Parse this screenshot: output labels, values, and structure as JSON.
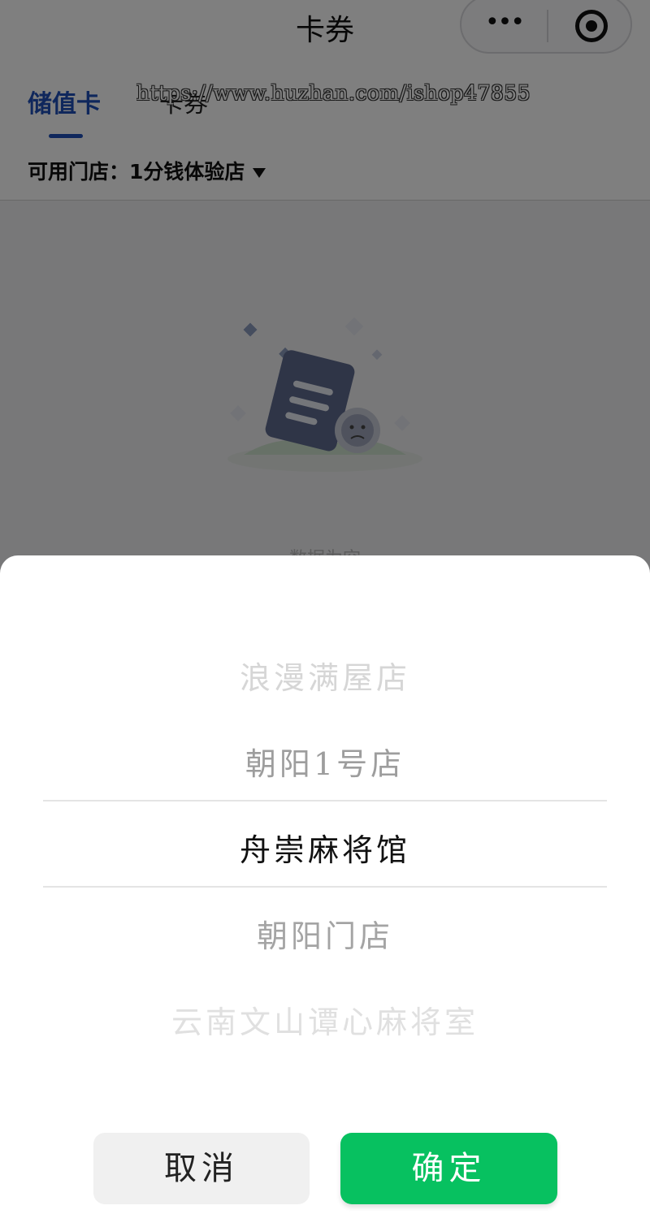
{
  "navbar": {
    "title": "卡券",
    "more_icon": "•••",
    "target_icon": "target-icon"
  },
  "tabs": [
    {
      "label": "储值卡",
      "active": true
    },
    {
      "label": "卡券",
      "active": false
    }
  ],
  "watermark": "https://www.huzhan.com/ishop47855",
  "store_filter": {
    "label": "可用门店：1分钱体验店"
  },
  "empty_state": {
    "text": "数据为空"
  },
  "picker": {
    "options": [
      "浪漫满屋店",
      "朝阳1号店",
      "舟崇麻将馆",
      "朝阳门店",
      "云南文山谭心麻将室"
    ],
    "selected_index": 2
  },
  "buttons": {
    "cancel": "取消",
    "confirm": "确定"
  },
  "colors": {
    "accent": "#1f4fb8",
    "confirm": "#07c160"
  }
}
